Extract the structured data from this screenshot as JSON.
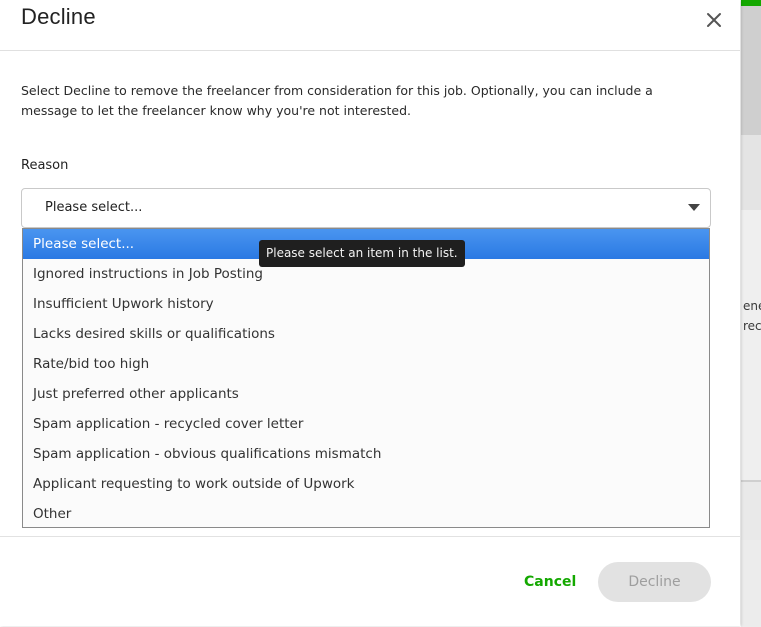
{
  "modal": {
    "title": "Decline",
    "description": "Select Decline to remove the freelancer from consideration for this job. Optionally, you can include a message to let the freelancer know why you're not interested.",
    "reason_label": "Reason"
  },
  "select": {
    "value": "Please select...",
    "options": [
      "Please select...",
      "Ignored instructions in Job Posting",
      "Insufficient Upwork history",
      "Lacks desired skills or qualifications",
      "Rate/bid too high",
      "Just preferred other applicants",
      "Spam application - recycled cover letter",
      "Spam application - obvious qualifications mismatch",
      "Applicant requesting to work outside of Upwork",
      "Other"
    ],
    "selected_index": 0
  },
  "tooltip": {
    "text": "Please select an item in the list."
  },
  "footer": {
    "cancel_label": "Cancel",
    "decline_label": "Decline"
  },
  "background": {
    "fragment_1": "ene",
    "fragment_2": "rec"
  },
  "colors": {
    "accent_green": "#14a800",
    "selected_blue": "#2f7fe6",
    "disabled_gray": "#e2e2e2"
  }
}
